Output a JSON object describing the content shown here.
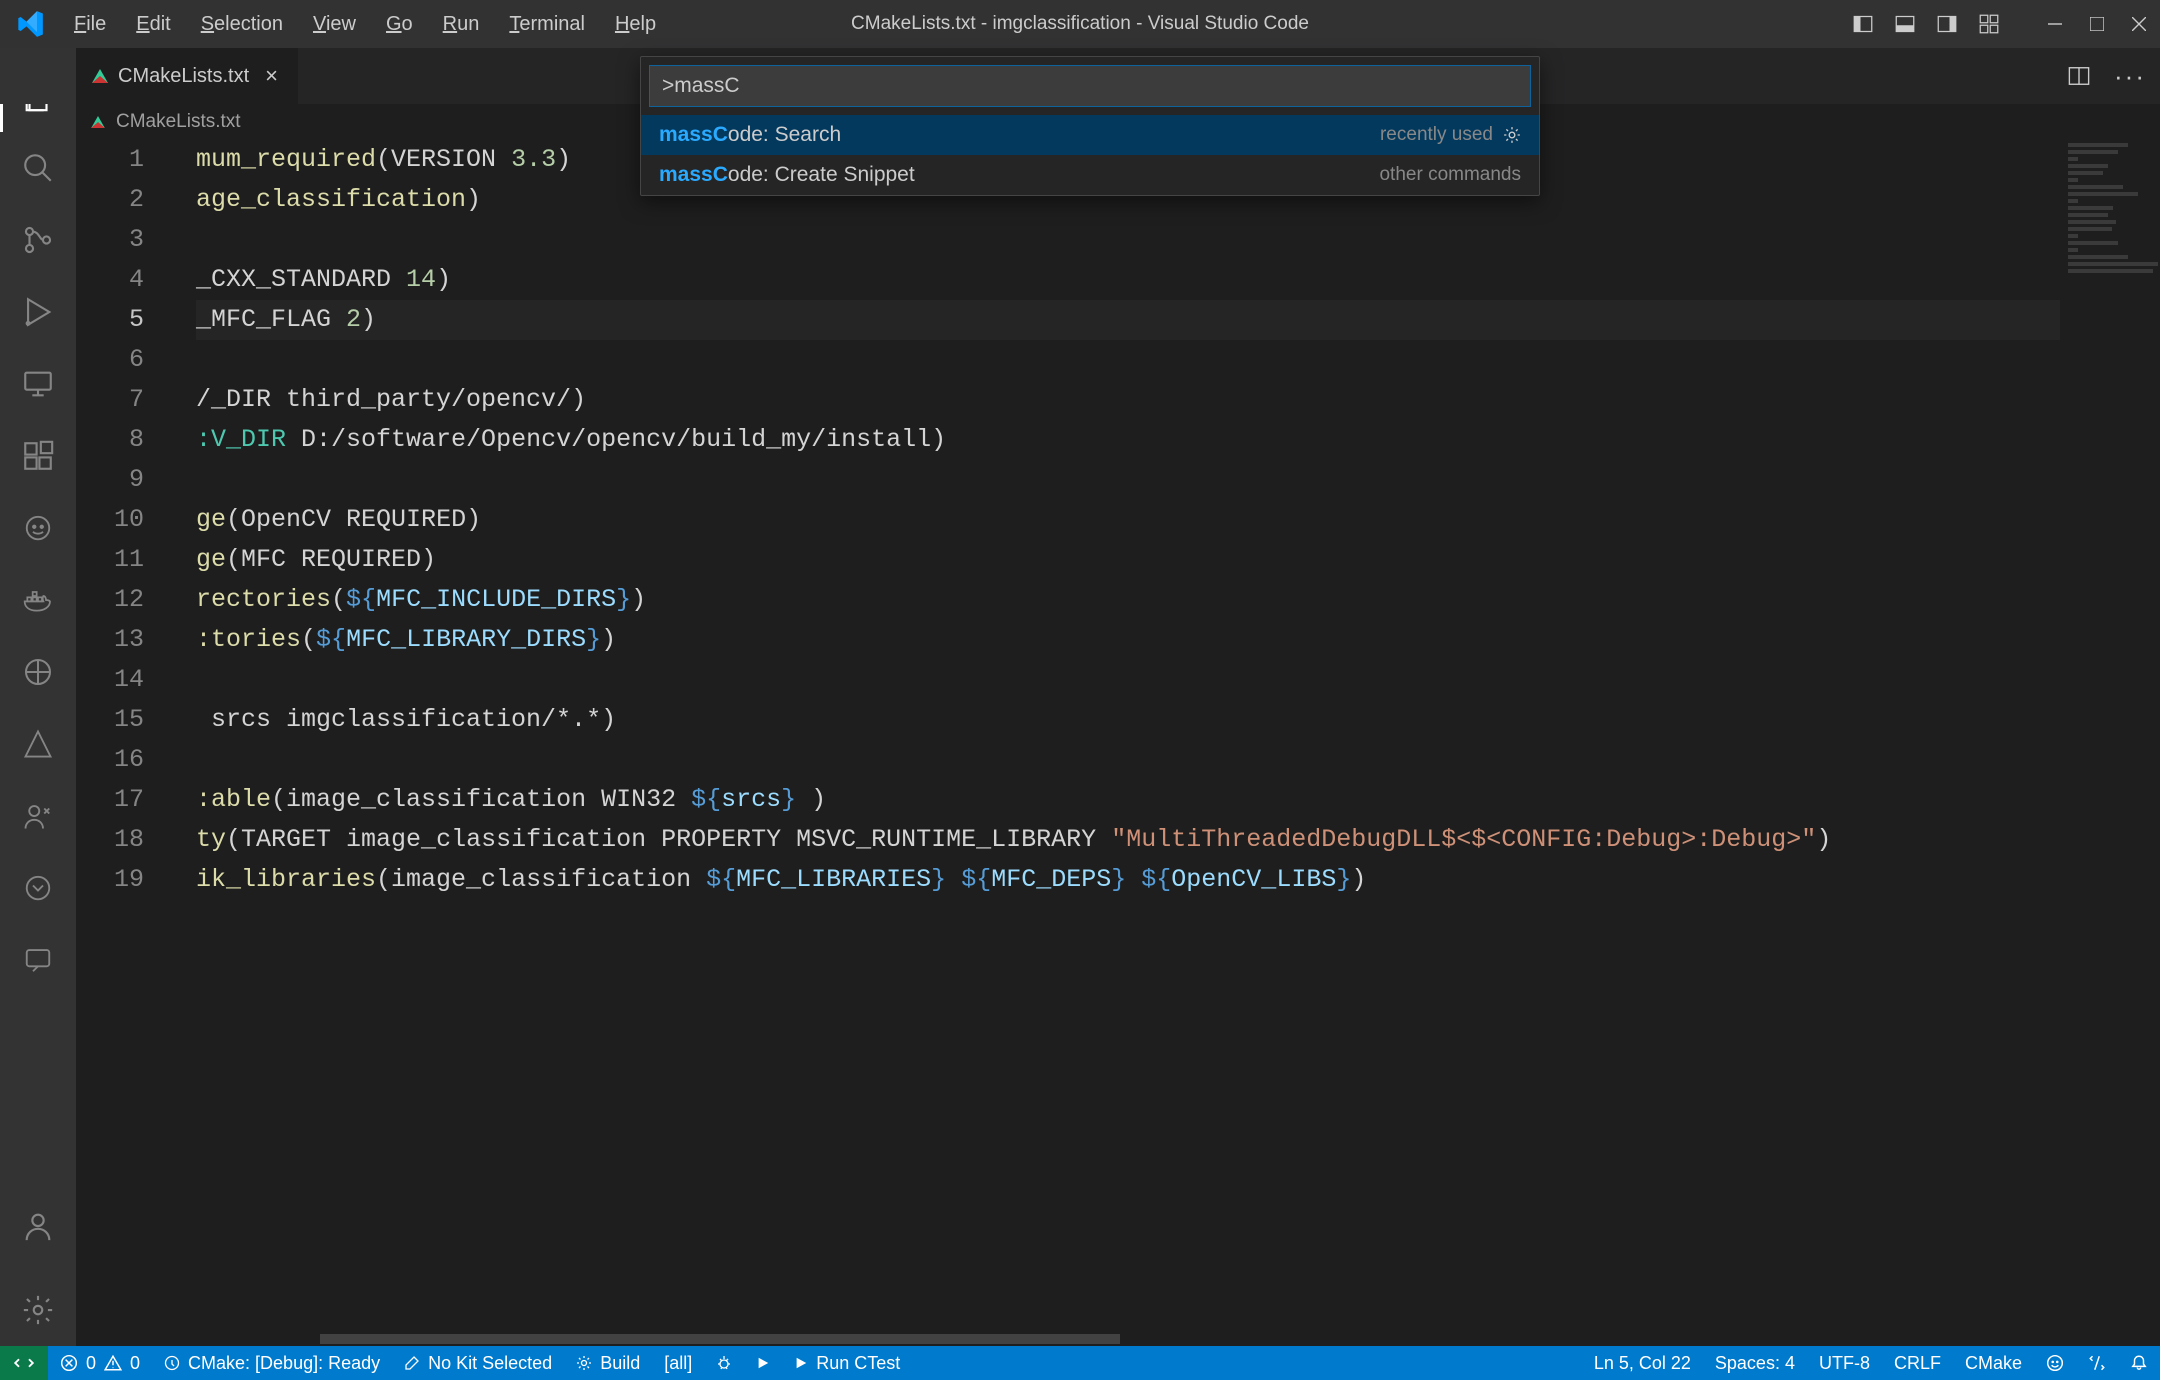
{
  "title": "CMakeLists.txt - imgclassification - Visual Studio Code",
  "menu": [
    "File",
    "Edit",
    "Selection",
    "View",
    "Go",
    "Run",
    "Terminal",
    "Help"
  ],
  "tab": {
    "label": "CMakeLists.txt"
  },
  "breadcrumb": {
    "label": "CMakeLists.txt"
  },
  "palette": {
    "input": ">massC",
    "items": [
      {
        "hi": "massC",
        "rest": "ode: Search",
        "hint": "recently used",
        "gear": true
      },
      {
        "hi": "massC",
        "rest": "ode: Create Snippet",
        "hint": "other commands",
        "gear": false
      }
    ]
  },
  "code": {
    "lines": [
      [
        {
          "c": "fn",
          "t": "mum_required"
        },
        {
          "c": "pn",
          "t": "("
        },
        {
          "c": "id",
          "t": "VERSION "
        },
        {
          "c": "num",
          "t": "3.3"
        },
        {
          "c": "pn",
          "t": ")"
        }
      ],
      [
        {
          "c": "fn",
          "t": "age_classification"
        },
        {
          "c": "pn",
          "t": ")"
        }
      ],
      [],
      [
        {
          "c": "id",
          "t": "_CXX_STANDARD "
        },
        {
          "c": "num",
          "t": "14"
        },
        {
          "c": "pn",
          "t": ")"
        }
      ],
      [
        {
          "c": "id",
          "t": "_MFC_FLAG "
        },
        {
          "c": "num",
          "t": "2"
        },
        {
          "c": "pn",
          "t": ")"
        }
      ],
      [],
      [
        {
          "c": "id",
          "t": "/_DIR third_party/opencv/"
        },
        {
          "c": "pn",
          "t": ")"
        }
      ],
      [
        {
          "c": "mac",
          "t": ":V_DIR "
        },
        {
          "c": "id",
          "t": "D:/software/Opencv/opencv/build_my/install"
        },
        {
          "c": "pn",
          "t": ")"
        }
      ],
      [],
      [
        {
          "c": "fn",
          "t": "ge"
        },
        {
          "c": "pn",
          "t": "("
        },
        {
          "c": "id",
          "t": "OpenCV REQUIRED"
        },
        {
          "c": "pn",
          "t": ")"
        }
      ],
      [
        {
          "c": "fn",
          "t": "ge"
        },
        {
          "c": "pn",
          "t": "("
        },
        {
          "c": "id",
          "t": "MFC REQUIRED"
        },
        {
          "c": "pn",
          "t": ")"
        }
      ],
      [
        {
          "c": "fn",
          "t": "rectories"
        },
        {
          "c": "pn",
          "t": "("
        },
        {
          "c": "kw",
          "t": "${"
        },
        {
          "c": "var",
          "t": "MFC_INCLUDE_DIRS"
        },
        {
          "c": "kw",
          "t": "}"
        },
        {
          "c": "pn",
          "t": ")"
        }
      ],
      [
        {
          "c": "fn",
          "t": ":tories"
        },
        {
          "c": "pn",
          "t": "("
        },
        {
          "c": "kw",
          "t": "${"
        },
        {
          "c": "var",
          "t": "MFC_LIBRARY_DIRS"
        },
        {
          "c": "kw",
          "t": "}"
        },
        {
          "c": "pn",
          "t": ")"
        }
      ],
      [],
      [
        {
          "c": "id",
          "t": " srcs imgclassification/*.*"
        },
        {
          "c": "pn",
          "t": ")"
        }
      ],
      [],
      [
        {
          "c": "fn",
          "t": ":able"
        },
        {
          "c": "pn",
          "t": "("
        },
        {
          "c": "id",
          "t": "image_classification WIN32 "
        },
        {
          "c": "kw",
          "t": "${"
        },
        {
          "c": "var",
          "t": "srcs"
        },
        {
          "c": "kw",
          "t": "}"
        },
        {
          "c": "pn",
          "t": " )"
        }
      ],
      [
        {
          "c": "fn",
          "t": "ty"
        },
        {
          "c": "pn",
          "t": "("
        },
        {
          "c": "id",
          "t": "TARGET image_classification PROPERTY MSVC_RUNTIME_LIBRARY "
        },
        {
          "c": "str",
          "t": "\"MultiThreadedDebugDLL$<$<CONFIG:Debug>:Debug>\""
        },
        {
          "c": "pn",
          "t": ")"
        }
      ],
      [
        {
          "c": "fn",
          "t": "ik_libraries"
        },
        {
          "c": "pn",
          "t": "("
        },
        {
          "c": "id",
          "t": "image_classification "
        },
        {
          "c": "kw",
          "t": "${"
        },
        {
          "c": "var",
          "t": "MFC_LIBRARIES"
        },
        {
          "c": "kw",
          "t": "}"
        },
        {
          "c": "id",
          "t": " "
        },
        {
          "c": "kw",
          "t": "${"
        },
        {
          "c": "var",
          "t": "MFC_DEPS"
        },
        {
          "c": "kw",
          "t": "}"
        },
        {
          "c": "id",
          "t": " "
        },
        {
          "c": "kw",
          "t": "${"
        },
        {
          "c": "var",
          "t": "OpenCV_LIBS"
        },
        {
          "c": "kw",
          "t": "}"
        },
        {
          "c": "pn",
          "t": ")"
        }
      ]
    ],
    "current_line_index": 4
  },
  "status": {
    "errors": "0",
    "warnings": "0",
    "cmake": "CMake: [Debug]: Ready",
    "kit": "No Kit Selected",
    "build": "Build",
    "target": "[all]",
    "run": "Run CTest",
    "lncol": "Ln 5, Col 22",
    "spaces": "Spaces: 4",
    "encoding": "UTF-8",
    "eol": "CRLF",
    "lang": "CMake"
  }
}
